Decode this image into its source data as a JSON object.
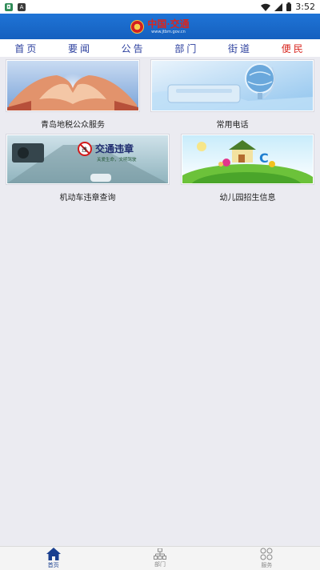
{
  "status_bar": {
    "time": "3:52",
    "left_icons": [
      "notification-app-icon",
      "notification-a-icon"
    ],
    "right_icons": [
      "wifi-icon",
      "signal-icon",
      "battery-icon"
    ]
  },
  "header": {
    "title": "中国·交通",
    "subtitle": "www.jtbm.gov.cn",
    "emblem_icon": "national-emblem-icon",
    "background_color": "#1a6ad0"
  },
  "nav": {
    "items": [
      {
        "label": "首页"
      },
      {
        "label": "要闻"
      },
      {
        "label": "公告"
      },
      {
        "label": "部门"
      },
      {
        "label": "街道"
      },
      {
        "label": "便民"
      }
    ],
    "active_index": 5,
    "active_color": "#d8261f",
    "text_color": "#2b3f9e"
  },
  "services": [
    {
      "label": "青岛地税公众服务",
      "image": "heart-hands-image"
    },
    {
      "label": "常用电话",
      "image": "globe-phone-image"
    },
    {
      "label": "机动车违章查询",
      "image": "traffic-violation-image",
      "image_text": "交通违章",
      "image_subtext": "关爱生命，文明驾驶"
    },
    {
      "label": "幼儿园招生信息",
      "image": "kindergarten-image"
    }
  ],
  "bottom_tabs": [
    {
      "label": "首页",
      "icon": "home-icon",
      "active": true
    },
    {
      "label": "部门",
      "icon": "org-chart-icon",
      "active": false
    },
    {
      "label": "服务",
      "icon": "grid-circles-icon",
      "active": false
    }
  ]
}
